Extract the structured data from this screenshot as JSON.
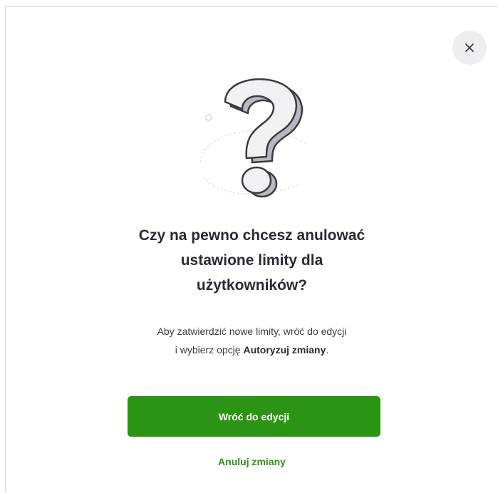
{
  "dialog": {
    "close_icon": "close-icon",
    "illustration_icon": "question-mark-icon",
    "title_lines": [
      "Czy na pewno chcesz anulować",
      "ustawione limity dla",
      "użytkowników?"
    ],
    "description": {
      "line1": "Aby zatwierdzić nowe limity, wróć do edycji",
      "line2_prefix": "i wybierz opcję ",
      "line2_bold": "Autoryzuj zmiany",
      "line2_suffix": "."
    },
    "primary_button_label": "Wróć do edycji",
    "secondary_button_label": "Anuluj zmiany"
  },
  "colors": {
    "accent": "#2c9414",
    "title": "#2a2a33",
    "close_bg": "#eeeef1"
  }
}
